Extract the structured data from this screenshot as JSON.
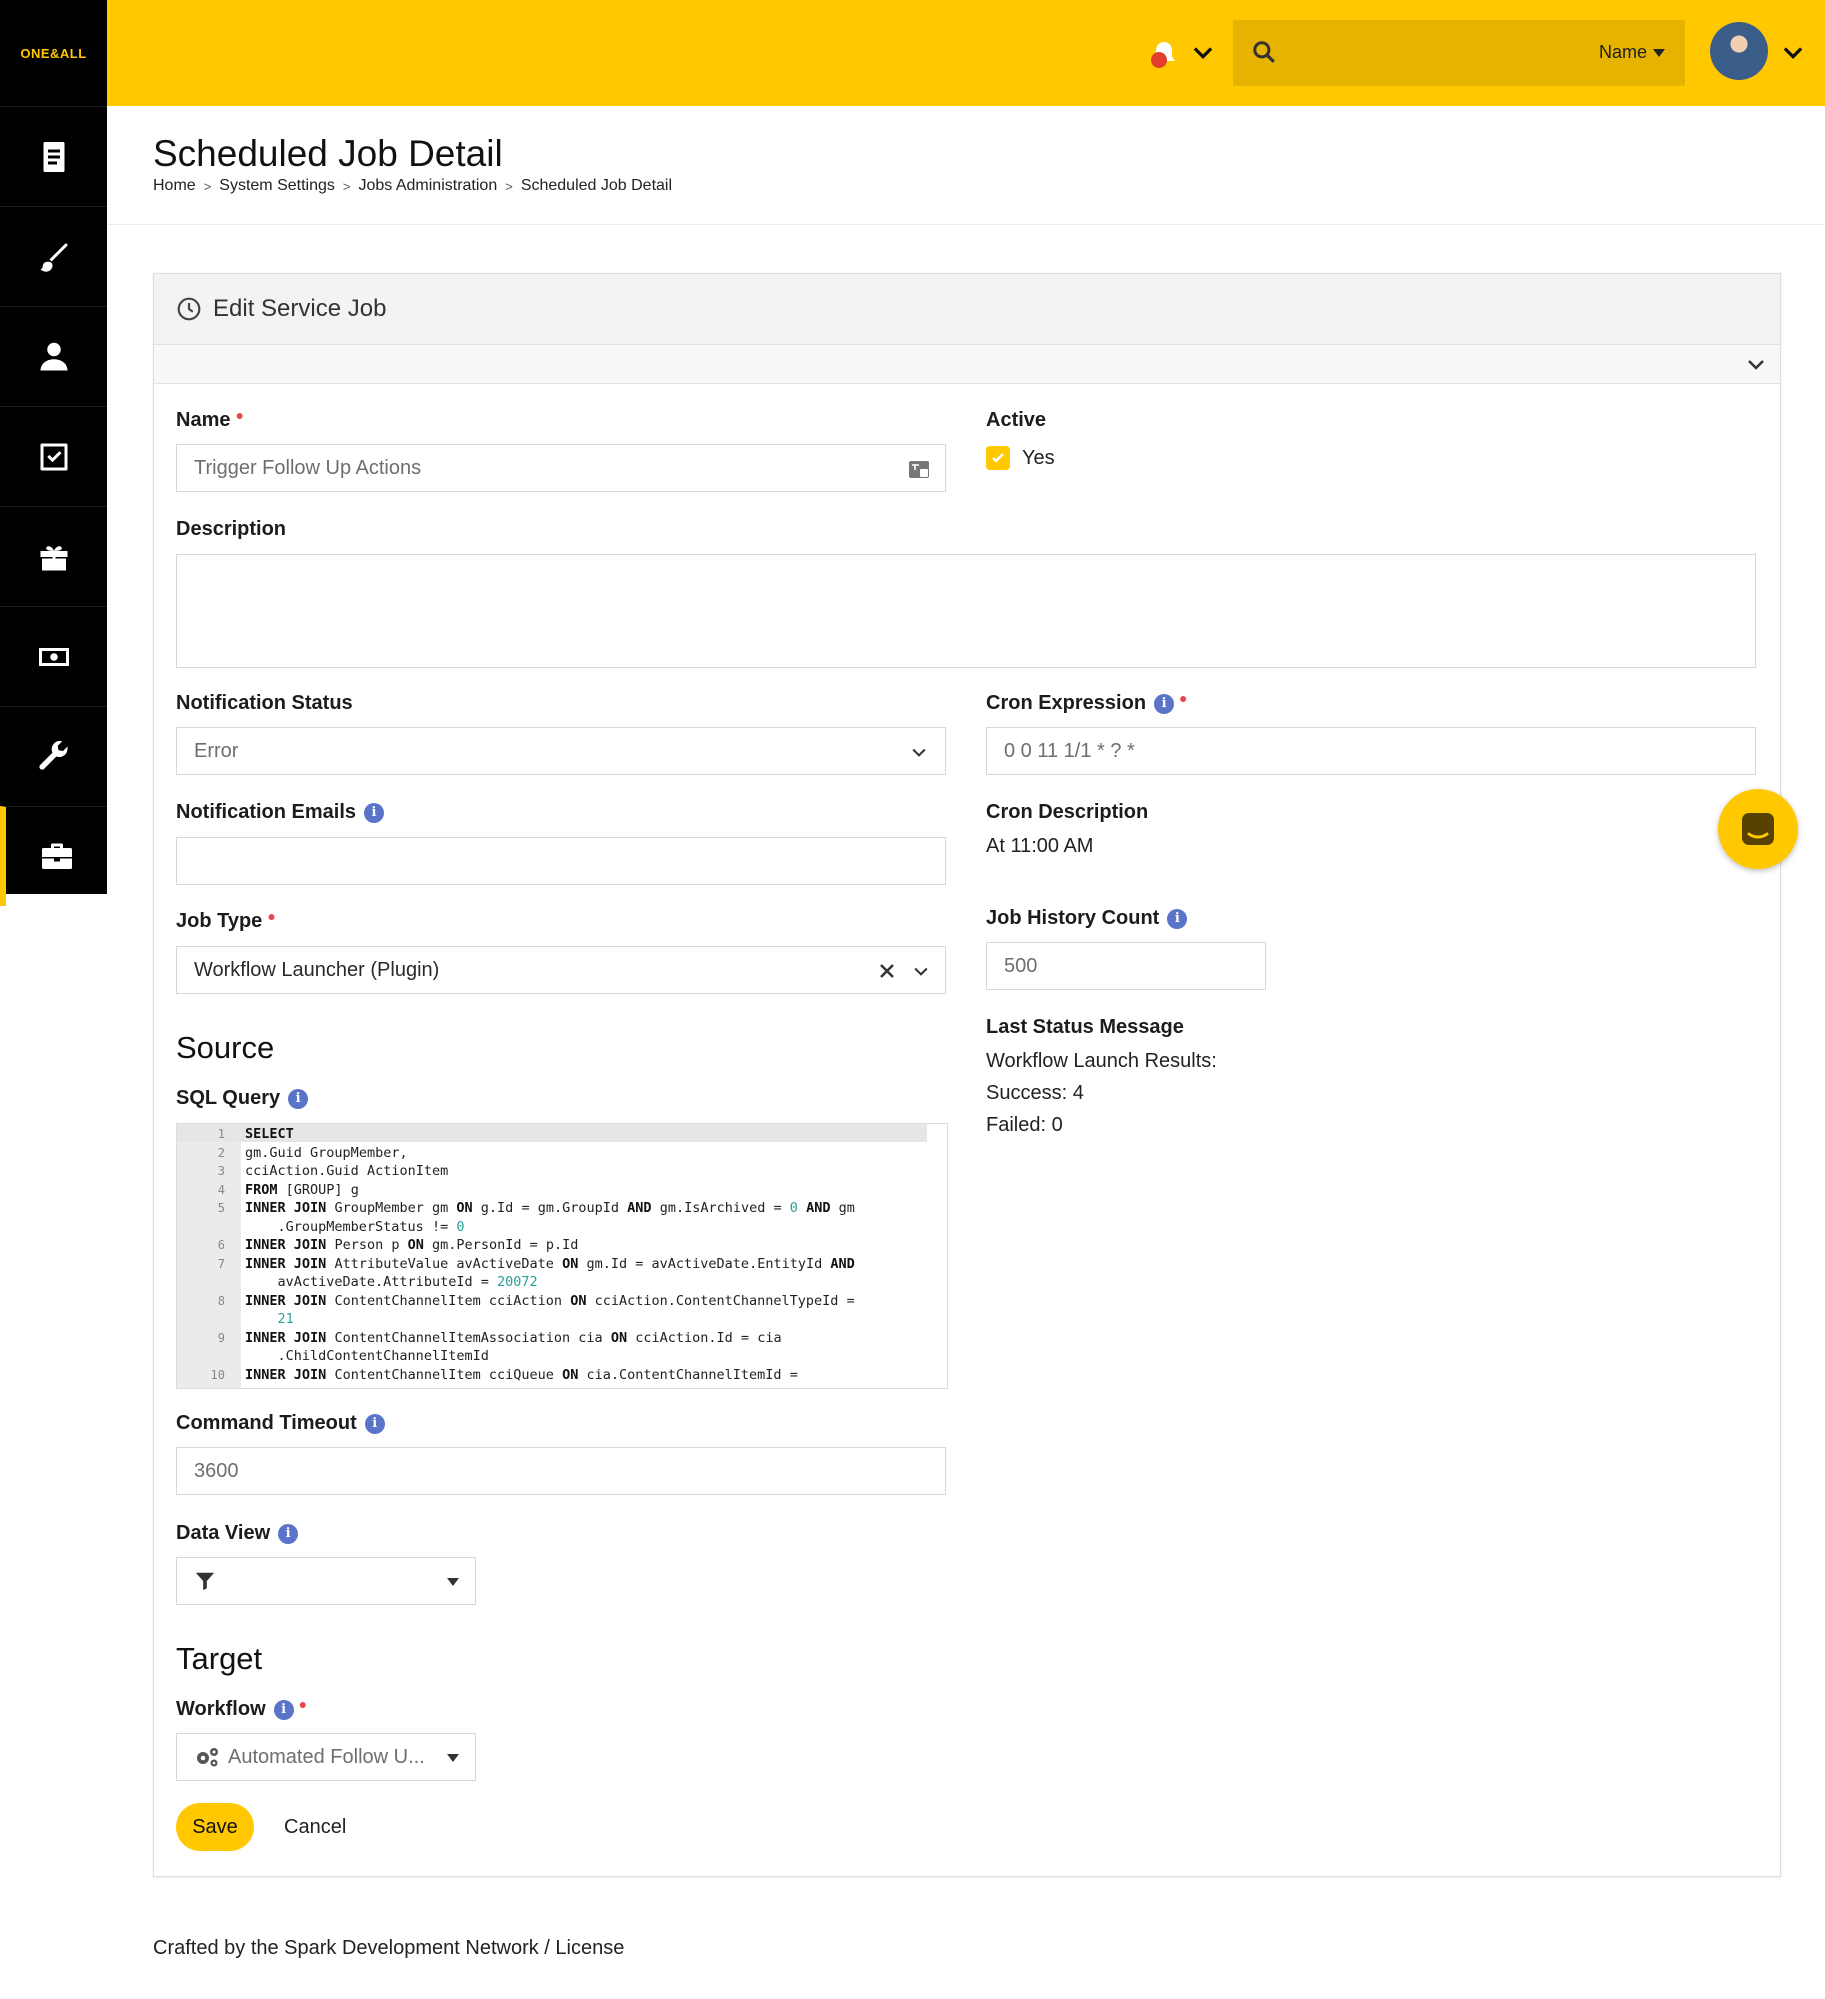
{
  "app": {
    "logo": "ONE&ALL"
  },
  "topbar": {
    "search_filter": "Name",
    "search_placeholder": ""
  },
  "page": {
    "title": "Scheduled Job Detail",
    "breadcrumb": [
      "Home",
      "System Settings",
      "Jobs Administration",
      "Scheduled Job Detail"
    ]
  },
  "panel": {
    "title": "Edit Service Job"
  },
  "form": {
    "name": {
      "label": "Name",
      "value": "Trigger Follow Up Actions"
    },
    "active": {
      "label": "Active",
      "checkbox_label": "Yes",
      "checked": true
    },
    "description": {
      "label": "Description",
      "value": ""
    },
    "notification_status": {
      "label": "Notification Status",
      "value": "Error"
    },
    "cron_expression": {
      "label": "Cron Expression",
      "value": "0 0 11 1/1 * ? *"
    },
    "notification_emails": {
      "label": "Notification Emails",
      "value": ""
    },
    "cron_description": {
      "label": "Cron Description",
      "value": "At 11:00 AM"
    },
    "job_type": {
      "label": "Job Type",
      "value": "Workflow Launcher (Plugin)"
    },
    "job_history_count": {
      "label": "Job History Count",
      "value": "500"
    },
    "last_status_message": {
      "label": "Last Status Message",
      "lines": [
        "Workflow Launch Results:",
        "Success: 4",
        "Failed: 0"
      ]
    },
    "source_title": "Source",
    "sql_query": {
      "label": "SQL Query",
      "lines": [
        {
          "n": "1",
          "text": "SELECT"
        },
        {
          "n": "2",
          "text": "gm.Guid GroupMember,"
        },
        {
          "n": "3",
          "text": "cciAction.Guid ActionItem"
        },
        {
          "n": "4",
          "text": "FROM [GROUP] g"
        },
        {
          "n": "5",
          "text": "INNER JOIN GroupMember gm ON g.Id = gm.GroupId AND gm.IsArchived = 0 AND gm"
        },
        {
          "n": "",
          "text": "    .GroupMemberStatus != 0"
        },
        {
          "n": "6",
          "text": "INNER JOIN Person p ON gm.PersonId = p.Id"
        },
        {
          "n": "7",
          "text": "INNER JOIN AttributeValue avActiveDate ON gm.Id = avActiveDate.EntityId AND"
        },
        {
          "n": "",
          "text": "    avActiveDate.AttributeId = 20072"
        },
        {
          "n": "8",
          "text": "INNER JOIN ContentChannelItem cciAction ON cciAction.ContentChannelTypeId ="
        },
        {
          "n": "",
          "text": "    21"
        },
        {
          "n": "9",
          "text": "INNER JOIN ContentChannelItemAssociation cia ON cciAction.Id = cia"
        },
        {
          "n": "",
          "text": "    .ChildContentChannelItemId"
        },
        {
          "n": "10",
          "text": "INNER JOIN ContentChannelItem cciQueue ON cia.ContentChannelItemId ="
        }
      ]
    },
    "command_timeout": {
      "label": "Command Timeout",
      "value": "3600"
    },
    "data_view": {
      "label": "Data View",
      "value": ""
    },
    "target_title": "Target",
    "workflow": {
      "label": "Workflow",
      "value": "Automated Follow U..."
    },
    "save_label": "Save",
    "cancel_label": "Cancel"
  },
  "footer": {
    "text": "Crafted by the Spark Development Network / License"
  },
  "colors": {
    "accent": "#ffc800",
    "sidebar": "#000000",
    "info": "#5a74c9",
    "required": "#e5484d"
  }
}
